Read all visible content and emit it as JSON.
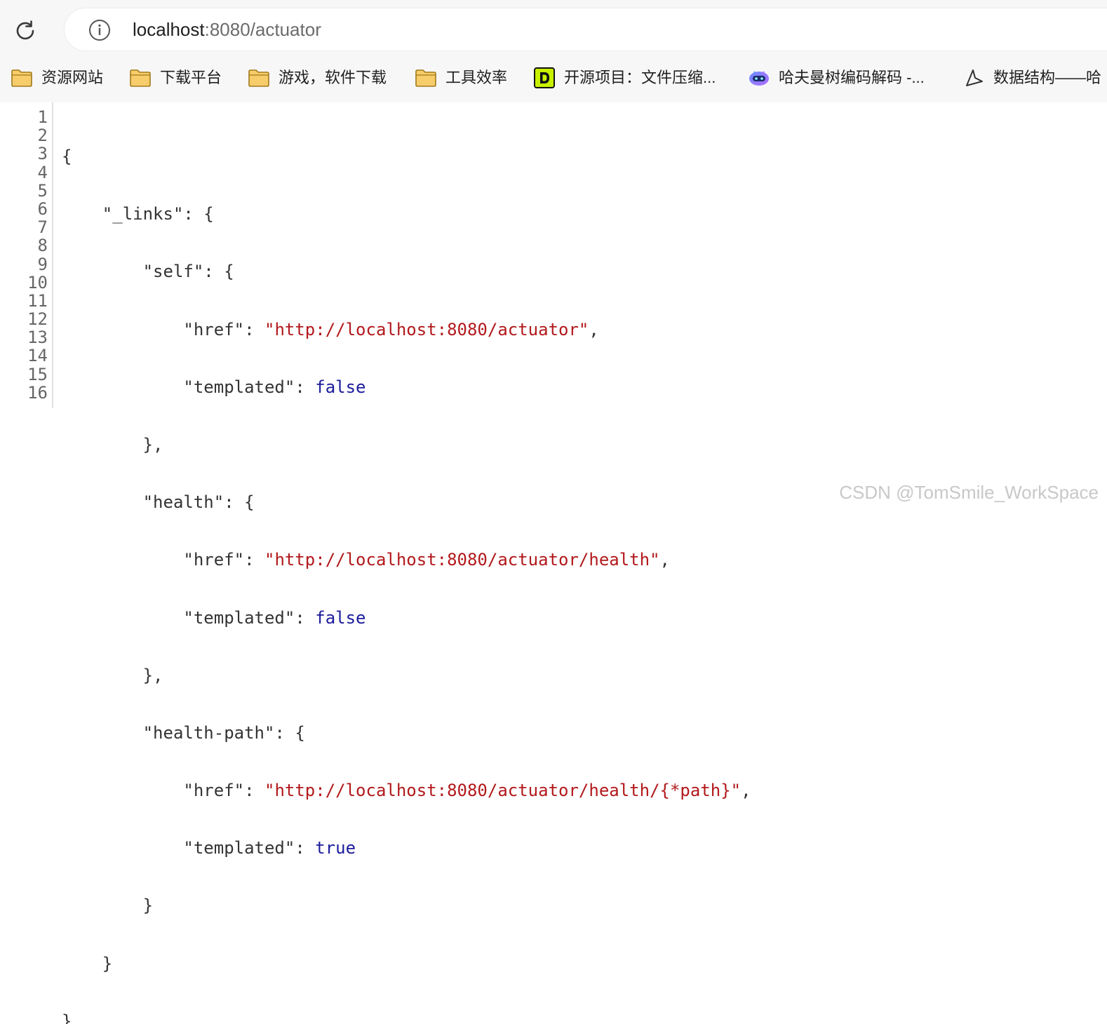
{
  "browser": {
    "url_host": "localhost",
    "url_rest": ":8080/actuator",
    "reload_icon": "reload-icon",
    "info_icon": "info-icon"
  },
  "bookmarks": [
    {
      "label": "资源网站",
      "icon": "folder-icon"
    },
    {
      "label": "下载平台",
      "icon": "folder-icon"
    },
    {
      "label": "游戏，软件下载",
      "icon": "folder-icon"
    },
    {
      "label": "工具效率",
      "icon": "folder-icon"
    },
    {
      "label": "开源项目：文件压缩...",
      "icon": "d-logo-icon"
    },
    {
      "label": "哈夫曼树编码解码 -...",
      "icon": "robot-icon"
    },
    {
      "label": "数据结构——哈",
      "icon": "paper-plane-icon"
    }
  ],
  "json_viewer": {
    "line_numbers": [
      "1",
      "2",
      "3",
      "4",
      "5",
      "6",
      "7",
      "8",
      "9",
      "10",
      "11",
      "12",
      "13",
      "14",
      "15",
      "16"
    ],
    "keys": {
      "links": "\"_links\"",
      "self": "\"self\"",
      "health": "\"health\"",
      "health_path": "\"health-path\"",
      "href": "\"href\"",
      "templated": "\"templated\""
    },
    "values": {
      "self_href": "\"http://localhost:8080/actuator\"",
      "self_templated": "false",
      "health_href": "\"http://localhost:8080/actuator/health\"",
      "health_templated": "false",
      "health_path_href": "\"http://localhost:8080/actuator/health/{*path}\"",
      "health_path_templated": "true"
    }
  },
  "watermark": "CSDN @TomSmile_WorkSpace",
  "colors": {
    "string": "#b2191c",
    "boolean": "#1c1b9b",
    "punctuation": "#333333",
    "line_number": "#666666",
    "folder": "#f6cd6a"
  }
}
